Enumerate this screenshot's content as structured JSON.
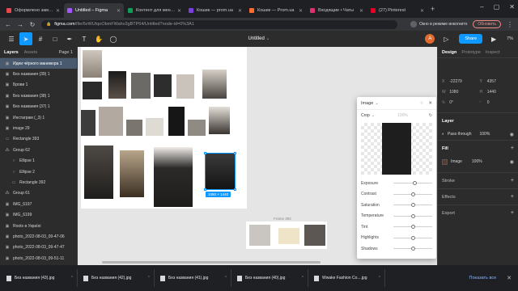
{
  "browser": {
    "tabs": [
      {
        "title": "Оформлено замовл",
        "color": "#e8474f",
        "active": false
      },
      {
        "title": "Untitled – Figma",
        "color": "#a259ff",
        "active": true
      },
      {
        "title": "Контент для меню -",
        "color": "#0f9d58",
        "active": false
      },
      {
        "title": "Кошик — prom.ua",
        "color": "#7b3fe4",
        "active": false
      },
      {
        "title": "Кошик — Prom.ua",
        "color": "#ff6d2e",
        "active": false
      },
      {
        "title": "Входящие • Чаты",
        "color": "#e0306e",
        "active": false
      },
      {
        "title": "(27) Pinterest",
        "color": "#e60023",
        "active": false
      }
    ],
    "url_host": "figma.com",
    "url_path": "/file/6vWUIqoObmFWahv2gBTP64/Untitled?node-id=0%3A1",
    "incognito_label": "Окно в режиме инкогнито",
    "update_label": "Обновить"
  },
  "figma": {
    "title": "Untitled",
    "avatar_initial": "A",
    "share_label": "Share",
    "zoom": "7%"
  },
  "layers": {
    "tab_layers": "Layers",
    "tab_assets": "Assets",
    "page": "Page 1",
    "items": [
      {
        "name": "Идеи чёрного маникюра 1",
        "icon": "▣",
        "selected": true,
        "indent": false
      },
      {
        "name": "Без названия (39) 1",
        "icon": "▣",
        "selected": false,
        "indent": false
      },
      {
        "name": "Брови 1",
        "icon": "▣",
        "selected": false,
        "indent": false
      },
      {
        "name": "Без названия (38) 1",
        "icon": "▣",
        "selected": false,
        "indent": false
      },
      {
        "name": "Без названия (37) 1",
        "icon": "▣",
        "selected": false,
        "indent": false
      },
      {
        "name": "Инстаграм (_3) 1",
        "icon": "▣",
        "selected": false,
        "indent": false
      },
      {
        "name": "image 29",
        "icon": "▣",
        "selected": false,
        "indent": false
      },
      {
        "name": "Rectangle 393",
        "icon": "▭",
        "selected": false,
        "indent": false
      },
      {
        "name": "Group 62",
        "icon": "⁂",
        "selected": false,
        "indent": false
      },
      {
        "name": "Ellipse 1",
        "icon": "○",
        "selected": false,
        "indent": true
      },
      {
        "name": "Ellipse 2",
        "icon": "○",
        "selected": false,
        "indent": true
      },
      {
        "name": "Rectangle 392",
        "icon": "▭",
        "selected": false,
        "indent": true
      },
      {
        "name": "Group 61",
        "icon": "⁂",
        "selected": false,
        "indent": false
      },
      {
        "name": "IMG_6197",
        "icon": "▣",
        "selected": false,
        "indent": false
      },
      {
        "name": "IMG_6199",
        "icon": "▣",
        "selected": false,
        "indent": false
      },
      {
        "name": "Roots в Україні",
        "icon": "▣",
        "selected": false,
        "indent": false
      },
      {
        "name": "photo_2022-08-03_09-47-06",
        "icon": "▣",
        "selected": false,
        "indent": false
      },
      {
        "name": "photo_2022-08-03_09-47-47",
        "icon": "▣",
        "selected": false,
        "indent": false
      },
      {
        "name": "photo_2022-08-03_09-51-11",
        "icon": "▣",
        "selected": false,
        "indent": false
      }
    ]
  },
  "canvas": {
    "selection_size": "1080 × 1440",
    "frame_label": "Frame 392"
  },
  "image_popup": {
    "title": "Image",
    "mode": "Crop",
    "percent": "100%",
    "adjustments": [
      {
        "label": "Exposure",
        "value": 0.55
      },
      {
        "label": "Contrast",
        "value": 0.5
      },
      {
        "label": "Saturation",
        "value": 0.5
      },
      {
        "label": "Temperature",
        "value": 0.5
      },
      {
        "label": "Tint",
        "value": 0.5
      },
      {
        "label": "Highlights",
        "value": 0.5
      },
      {
        "label": "Shadows",
        "value": 0.5
      }
    ]
  },
  "design": {
    "tab_design": "Design",
    "tab_prototype": "Prototype",
    "tab_inspect": "Inspect",
    "x": "-22279",
    "y": "4357",
    "w": "1080",
    "h": "1440",
    "rotation": "0°",
    "radius": "0",
    "layer_title": "Layer",
    "blend": "Pass through",
    "opacity": "100%",
    "fill_title": "Fill",
    "fill_type": "Image",
    "fill_opacity": "100%",
    "stroke_title": "Stroke",
    "effects_title": "Effects",
    "export_title": "Export"
  },
  "downloads": {
    "items": [
      "Без названия (43).jpg",
      "Без названия (42).jpg",
      "Без названия (41).jpg",
      "Без названия (40).jpg",
      "Wwake Fashion Co....jpg"
    ],
    "show_all": "Показать все"
  }
}
